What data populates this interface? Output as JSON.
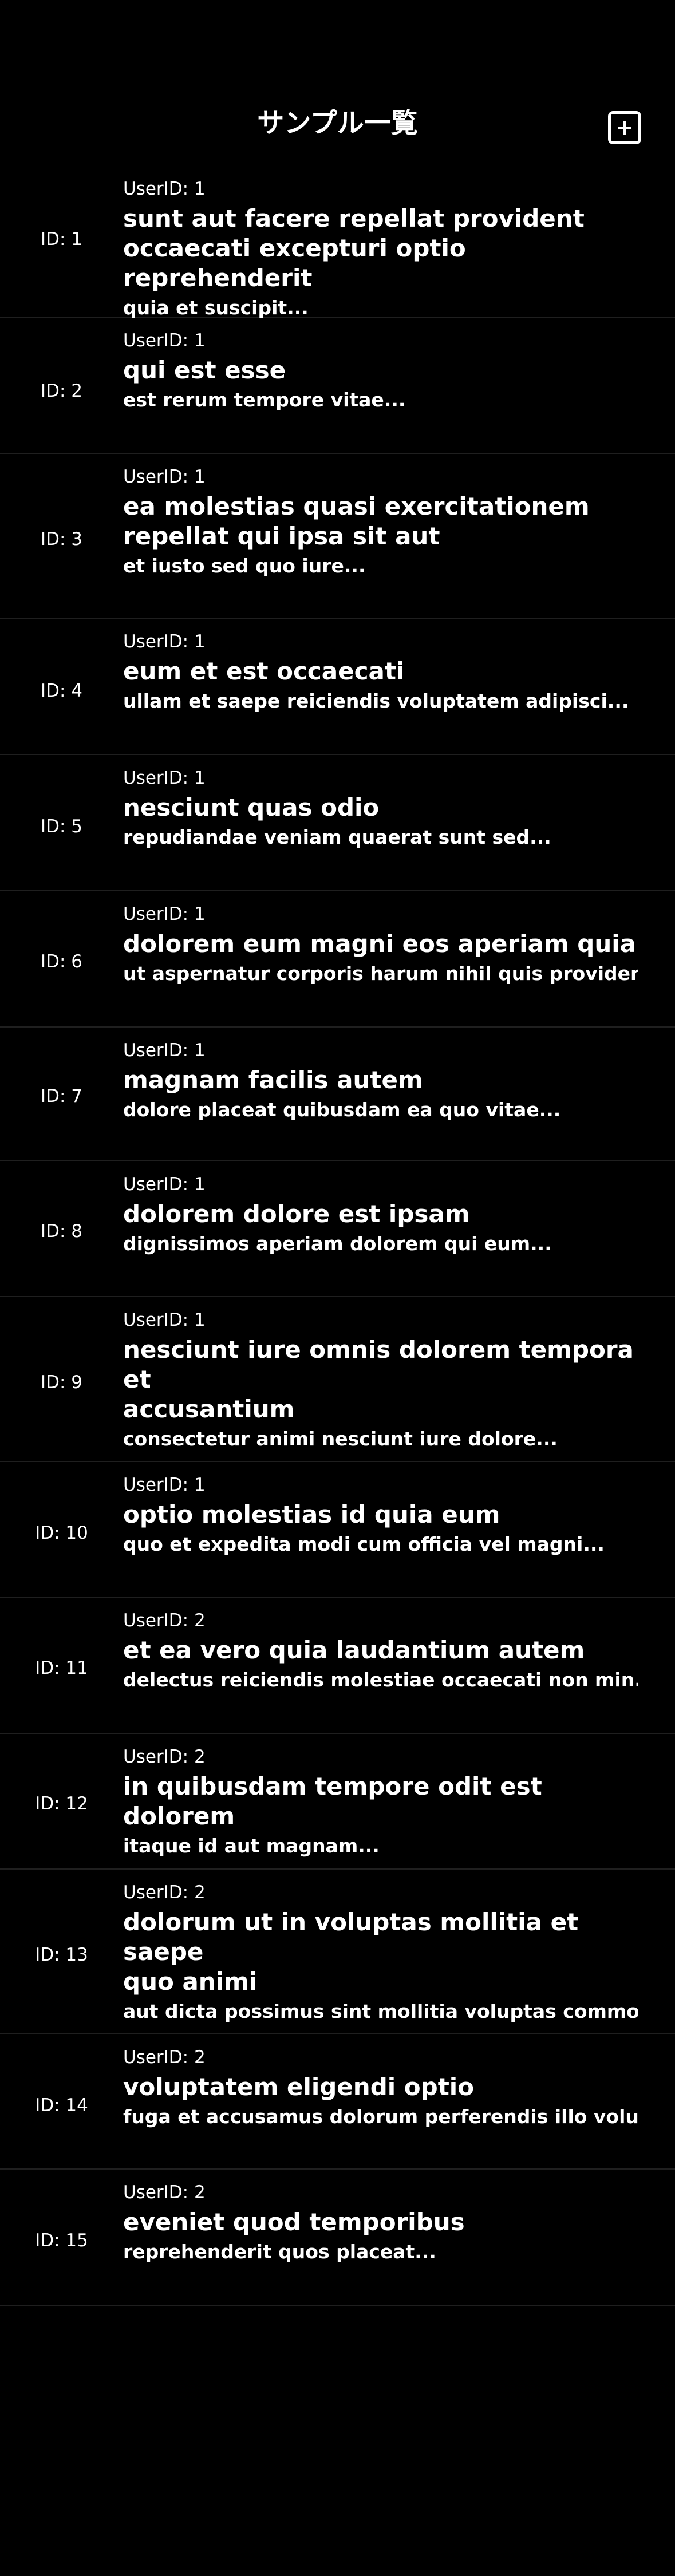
{
  "nav": {
    "title": "サンプル一覧",
    "add_icon": "plus-square-icon"
  },
  "posts": [
    {
      "id_label": "ID: 1",
      "user_label": "UserID: 1",
      "title": "sunt aut facere repellat provident\noccaecati excepturi optio reprehenderit",
      "body": "quia et suscipit..."
    },
    {
      "id_label": "ID: 2",
      "user_label": "UserID: 1",
      "title": "qui est esse",
      "body": "est rerum tempore vitae..."
    },
    {
      "id_label": "ID: 3",
      "user_label": "UserID: 1",
      "title": "ea molestias quasi exercitationem\nrepellat qui ipsa sit aut",
      "body": "et iusto sed quo iure..."
    },
    {
      "id_label": "ID: 4",
      "user_label": "UserID: 1",
      "title": "eum et est occaecati",
      "body": "ullam et saepe reiciendis voluptatem adipisci..."
    },
    {
      "id_label": "ID: 5",
      "user_label": "UserID: 1",
      "title": "nesciunt quas odio",
      "body": "repudiandae veniam quaerat sunt sed..."
    },
    {
      "id_label": "ID: 6",
      "user_label": "UserID: 1",
      "title": "dolorem eum magni eos aperiam quia",
      "body": "ut aspernatur corporis harum nihil quis providen..."
    },
    {
      "id_label": "ID: 7",
      "user_label": "UserID: 1",
      "title": "magnam facilis autem",
      "body": "dolore placeat quibusdam ea quo vitae..."
    },
    {
      "id_label": "ID: 8",
      "user_label": "UserID: 1",
      "title": "dolorem dolore est ipsam",
      "body": "dignissimos aperiam dolorem qui eum..."
    },
    {
      "id_label": "ID: 9",
      "user_label": "UserID: 1",
      "title": "nesciunt iure omnis dolorem tempora et\naccusantium",
      "body": "consectetur animi nesciunt iure dolore..."
    },
    {
      "id_label": "ID: 10",
      "user_label": "UserID: 1",
      "title": "optio molestias id quia eum",
      "body": "quo et expedita modi cum officia vel magni..."
    },
    {
      "id_label": "ID: 11",
      "user_label": "UserID: 2",
      "title": "et ea vero quia laudantium autem",
      "body": "delectus reiciendis molestiae occaecati non min..."
    },
    {
      "id_label": "ID: 12",
      "user_label": "UserID: 2",
      "title": "in quibusdam tempore odit est dolorem",
      "body": "itaque id aut magnam..."
    },
    {
      "id_label": "ID: 13",
      "user_label": "UserID: 2",
      "title": "dolorum ut in voluptas mollitia et saepe\nquo animi",
      "body": "aut dicta possimus sint mollitia voluptas commo..."
    },
    {
      "id_label": "ID: 14",
      "user_label": "UserID: 2",
      "title": "voluptatem eligendi optio",
      "body": "fuga et accusamus dolorum perferendis illo volu..."
    },
    {
      "id_label": "ID: 15",
      "user_label": "UserID: 2",
      "title": "eveniet quod temporibus",
      "body": "reprehenderit quos placeat..."
    }
  ]
}
